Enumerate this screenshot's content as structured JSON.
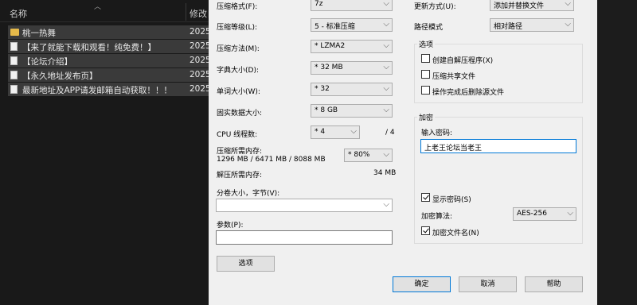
{
  "explorer": {
    "col_name": "名称",
    "col_date": "修改日",
    "files": [
      {
        "name": "桃一热舞",
        "date": "2025",
        "type": "folder"
      },
      {
        "name": "【来了就能下载和观看！纯免费！】",
        "date": "2025",
        "type": "file"
      },
      {
        "name": "【论坛介绍】",
        "date": "2025",
        "type": "file"
      },
      {
        "name": "【永久地址发布页】",
        "date": "2025",
        "type": "file"
      },
      {
        "name": "最新地址及APP请发邮箱自动获取！！！",
        "date": "2025",
        "type": "file"
      }
    ]
  },
  "dialog": {
    "archive_format": {
      "label": "压缩格式(F):",
      "value": "7z"
    },
    "compression_level": {
      "label": "压缩等级(L):",
      "value": "5 - 标准压缩"
    },
    "compression_method": {
      "label": "压缩方法(M):",
      "value": "* LZMA2"
    },
    "dictionary_size": {
      "label": "字典大小(D):",
      "value": "* 32 MB"
    },
    "word_size": {
      "label": "单词大小(W):",
      "value": "* 32"
    },
    "solid_block_size": {
      "label": "固实数据大小:",
      "value": "* 8 GB"
    },
    "cpu_threads": {
      "label": "CPU 线程数:",
      "value": "* 4",
      "total": "/ 4"
    },
    "memory_compress": {
      "label": "压缩所需内存:",
      "detail": "1296 MB / 6471 MB / 8088 MB",
      "percent": "* 80%"
    },
    "memory_decompress": {
      "label": "解压所需内存:",
      "value": "34 MB"
    },
    "split_volumes": {
      "label": "分卷大小，字节(V):",
      "value": ""
    },
    "parameters": {
      "label": "参数(P):",
      "value": ""
    },
    "options_button": "选项",
    "update_mode": {
      "label": "更新方式(U):",
      "value": "添加并替换文件"
    },
    "path_mode": {
      "label": "路径模式",
      "value": "相对路径"
    },
    "options_group": {
      "title": "选项",
      "items": [
        {
          "label": "创建自解压程序(X)",
          "checked": false
        },
        {
          "label": "压缩共享文件",
          "checked": false
        },
        {
          "label": "操作完成后删除源文件",
          "checked": false
        }
      ]
    },
    "encryption_group": {
      "title": "加密",
      "password_label": "输入密码:",
      "password_value": "上老王论坛当老王",
      "show_password": {
        "label": "显示密码(S)",
        "checked": true
      },
      "method_label": "加密算法:",
      "method_value": "AES-256",
      "encrypt_names": {
        "label": "加密文件名(N)",
        "checked": true
      }
    },
    "buttons": {
      "ok": "确定",
      "cancel": "取消",
      "help": "帮助"
    }
  }
}
